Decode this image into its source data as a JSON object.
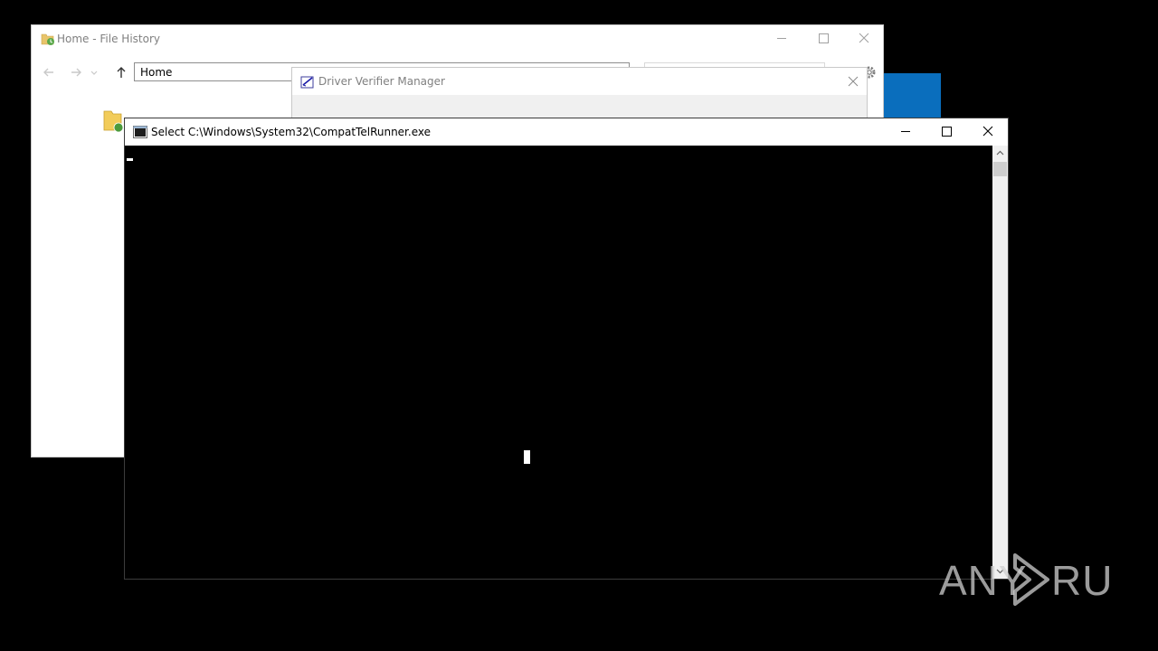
{
  "file_history": {
    "title": "Home - File History",
    "address": "Home",
    "icons": [
      "back-arrow-icon",
      "forward-arrow-icon",
      "dropdown-chevron-icon",
      "up-arrow-icon",
      "gear-icon",
      "folder-icon"
    ]
  },
  "driver_verifier": {
    "title": "Driver Verifier Manager"
  },
  "console": {
    "title": "Select C:\\Windows\\System32\\CompatTelRunner.exe"
  },
  "watermark": {
    "text": "ANY RUN"
  },
  "colors": {
    "desktop": "#000000",
    "accent_tile": "#0a6ebd",
    "console_bg": "#000000"
  }
}
